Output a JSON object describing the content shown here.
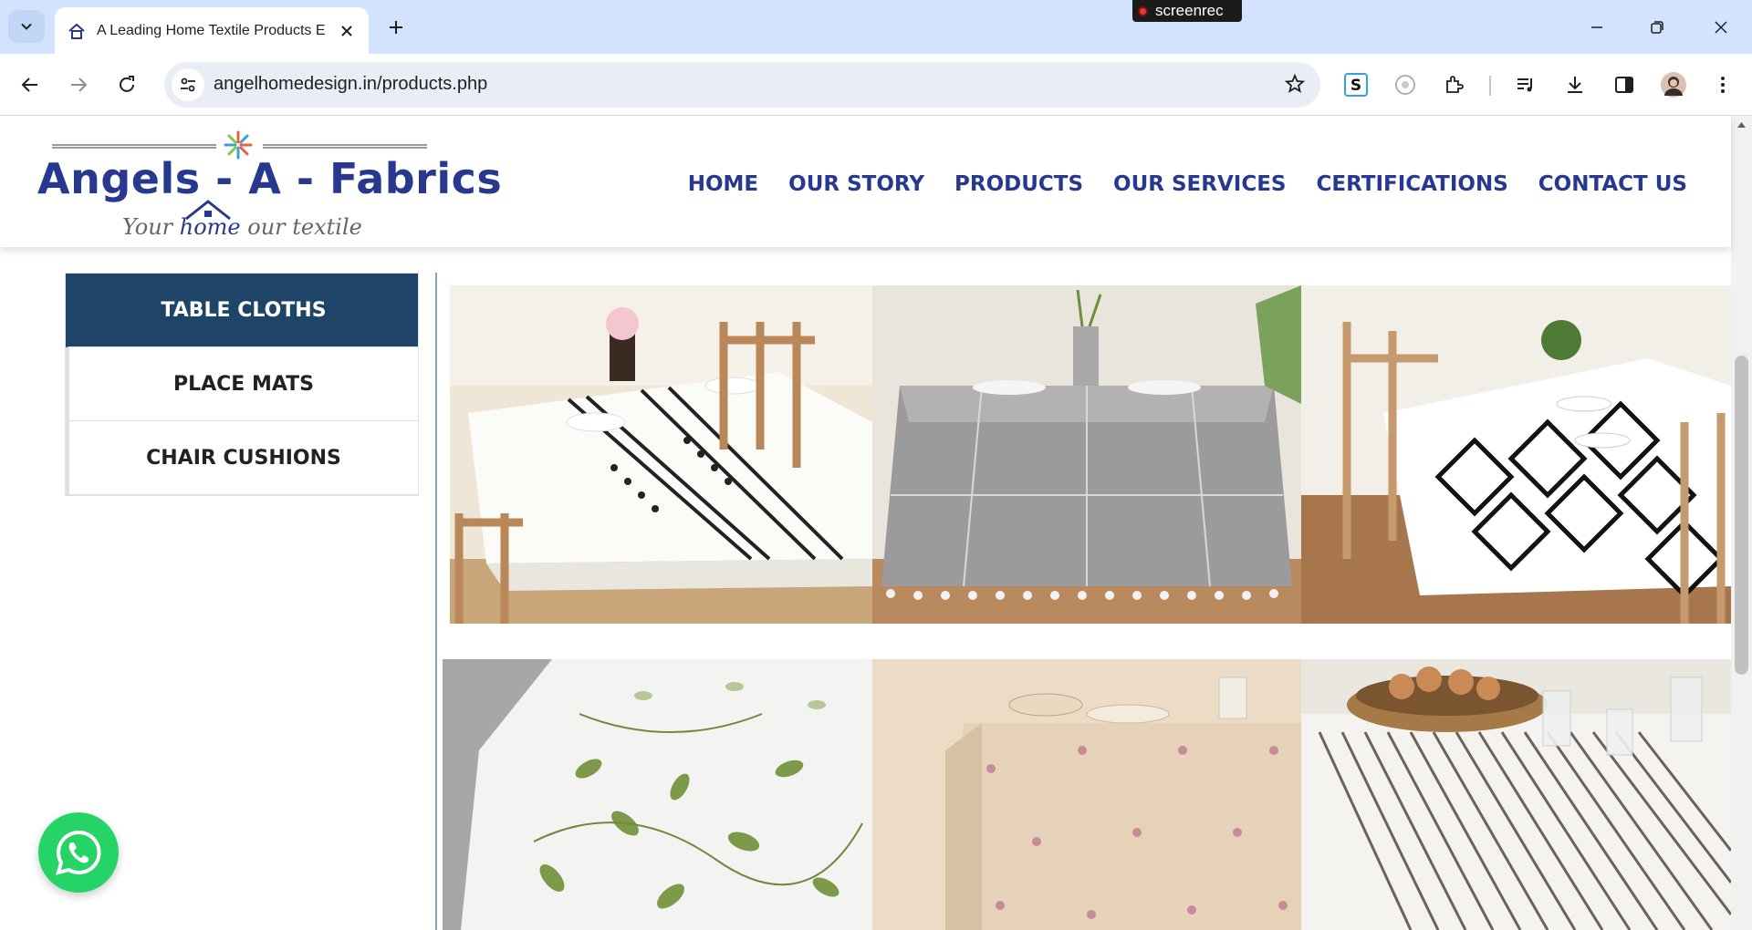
{
  "browser": {
    "tab_title": "A Leading Home Textile Products E",
    "url": "angelhomedesign.in/products.php",
    "screenrec_label": "screenrec"
  },
  "site": {
    "logo_name": "Angels - A - Fabrics",
    "logo_tagline_before": "Your ",
    "logo_tagline_home": "home",
    "logo_tagline_after": " our textile",
    "nav": [
      "HOME",
      "OUR STORY",
      "PRODUCTS",
      "OUR SERVICES",
      "CERTIFICATIONS",
      "CONTACT US"
    ]
  },
  "sidebar": {
    "items": [
      {
        "label": "TABLE CLOTHS",
        "active": true
      },
      {
        "label": "PLACE MATS",
        "active": false
      },
      {
        "label": "CHAIR CUSHIONS",
        "active": false
      }
    ]
  },
  "products": [
    {
      "name": "white-tablecloth-black-tribal-pattern"
    },
    {
      "name": "grey-linen-tablecloth-tassels"
    },
    {
      "name": "black-white-geometric-tablecloth"
    },
    {
      "name": "green-leaf-print-tablecloth"
    },
    {
      "name": "beige-floral-print-tablecloth"
    },
    {
      "name": "striped-tablecloth-bread-basket"
    }
  ],
  "colors": {
    "brand_blue": "#28388f",
    "sidebar_active": "#1e4568",
    "whatsapp_green": "#25d366"
  }
}
